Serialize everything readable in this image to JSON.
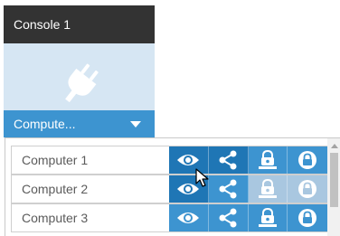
{
  "console": {
    "title": "Console 1",
    "icon": "plug-icon",
    "select_label": "Compute...",
    "select_icon": "chevron-down-icon"
  },
  "list": {
    "items": [
      {
        "label": "Computer 1",
        "actions": [
          "eye-icon",
          "share-icon",
          "user-lock-icon",
          "lock-icon"
        ]
      },
      {
        "label": "Computer 2",
        "actions": [
          "eye-icon",
          "share-icon",
          "user-lock-icon",
          "lock-icon"
        ]
      },
      {
        "label": "Computer 3",
        "actions": [
          "eye-icon",
          "share-icon",
          "user-lock-icon",
          "lock-icon"
        ]
      }
    ]
  },
  "colors": {
    "header_bg": "#333333",
    "console_bg": "#d6e6f3",
    "accent": "#3d94d0",
    "accent_dark": "#1f76b5",
    "accent_light": "#a9c7e0",
    "text": "#5b5b5b"
  }
}
